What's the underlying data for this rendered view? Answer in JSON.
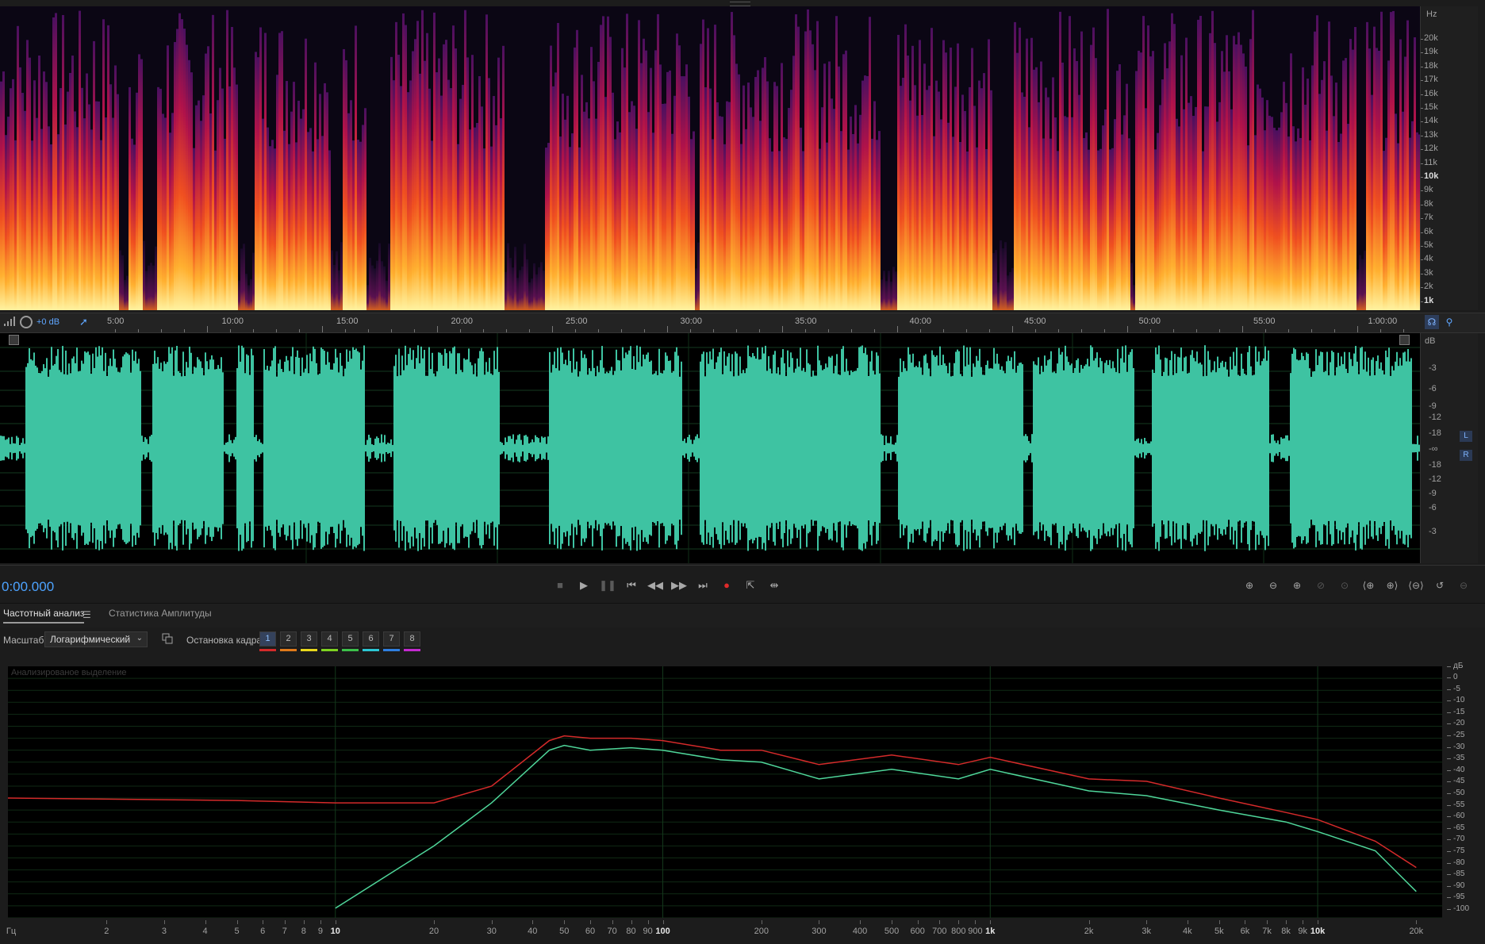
{
  "spectral": {
    "hz_unit": "Hz",
    "hz_ticks": [
      "20k",
      "19k",
      "18k",
      "17k",
      "16k",
      "15k",
      "14k",
      "13k",
      "12k",
      "11k",
      "10k",
      "9k",
      "8k",
      "7k",
      "6k",
      "5k",
      "4k",
      "3k",
      "2k",
      "1k"
    ]
  },
  "timeline": {
    "gain": "+0 dB",
    "labels": [
      "5:00",
      "10:00",
      "15:00",
      "20:00",
      "25:00",
      "30:00",
      "35:00",
      "40:00",
      "45:00",
      "50:00",
      "55:00",
      "1:00:00"
    ]
  },
  "waveform": {
    "db_unit": "dB",
    "db_ticks_top": [
      "-3",
      "-6",
      "-9",
      "-12",
      "-18",
      "-∞"
    ],
    "db_ticks_bottom": [
      "-18",
      "-12",
      "-9",
      "-6",
      "-3"
    ],
    "channels": [
      "L",
      "R"
    ],
    "color": "#3ec3a2"
  },
  "transport": {
    "timecode": "0:00.000",
    "buttons": [
      {
        "name": "stop-button",
        "glyph": "■",
        "enabled": false
      },
      {
        "name": "play-button",
        "glyph": "▶",
        "enabled": true
      },
      {
        "name": "pause-button",
        "glyph": "❚❚",
        "enabled": false
      },
      {
        "name": "go-to-start-button",
        "glyph": "⏮",
        "enabled": true
      },
      {
        "name": "rewind-button",
        "glyph": "◀◀",
        "enabled": true
      },
      {
        "name": "fast-forward-button",
        "glyph": "▶▶",
        "enabled": true
      },
      {
        "name": "go-to-end-button",
        "glyph": "⏭",
        "enabled": true
      },
      {
        "name": "record-button",
        "glyph": "●",
        "enabled": true
      },
      {
        "name": "loop-playback-button",
        "glyph": "⇱",
        "enabled": true
      },
      {
        "name": "skip-selection-button",
        "glyph": "⇹",
        "enabled": true
      }
    ],
    "zoom_buttons": [
      {
        "name": "zoom-in-amplitude-button",
        "glyph": "⊕",
        "enabled": true
      },
      {
        "name": "zoom-out-amplitude-button",
        "glyph": "⊖",
        "enabled": true
      },
      {
        "name": "zoom-in-time-button",
        "glyph": "⊕",
        "enabled": true
      },
      {
        "name": "zoom-out-full-button",
        "glyph": "⊘",
        "enabled": false
      },
      {
        "name": "zoom-selection-button",
        "glyph": "⊙",
        "enabled": false
      },
      {
        "name": "zoom-in-left-button",
        "glyph": "⟨⊕",
        "enabled": true
      },
      {
        "name": "zoom-in-right-button",
        "glyph": "⊕⟩",
        "enabled": true
      },
      {
        "name": "zoom-to-selection-button",
        "glyph": "⟨⊖⟩",
        "enabled": true
      },
      {
        "name": "zoom-reset-button",
        "glyph": "↺",
        "enabled": true
      },
      {
        "name": "zoom-out-button",
        "glyph": "⊖",
        "enabled": false
      }
    ]
  },
  "panel": {
    "tabs": [
      "Частотный анализ",
      "Статистика Амплитуды"
    ],
    "scale_label": "Масштаб:",
    "scale_value": "Логарифмический",
    "freeze_label": "Остановка кадра:",
    "frames": [
      {
        "label": "1",
        "color": "#d42a2a"
      },
      {
        "label": "2",
        "color": "#e07a1a"
      },
      {
        "label": "3",
        "color": "#e8d81c"
      },
      {
        "label": "4",
        "color": "#7ed321"
      },
      {
        "label": "5",
        "color": "#3cc04a"
      },
      {
        "label": "6",
        "color": "#2cc7d4"
      },
      {
        "label": "7",
        "color": "#2f7fe0"
      },
      {
        "label": "8",
        "color": "#c42ad0"
      }
    ],
    "spectrum_title": "Анализированое выделение",
    "db_unit": "дБ",
    "db_ticks": [
      "0",
      "-5",
      "-10",
      "-15",
      "-20",
      "-25",
      "-30",
      "-35",
      "-40",
      "-45",
      "-50",
      "-55",
      "-60",
      "-65",
      "-70",
      "-75",
      "-80",
      "-85",
      "-90",
      "-95",
      "-100"
    ],
    "hz_unit": "Гц",
    "freq_ticks": [
      "2",
      "3",
      "4",
      "5",
      "6",
      "7",
      "8",
      "9",
      "10",
      "20",
      "30",
      "40",
      "50",
      "60",
      "70",
      "80",
      "90",
      "100",
      "200",
      "300",
      "400",
      "500",
      "600",
      "700",
      "800",
      "900",
      "1k",
      "2k",
      "3k",
      "4k",
      "5k",
      "6k",
      "7k",
      "8k",
      "9k",
      "10k",
      "20k"
    ]
  },
  "chart_data": {
    "type": "line",
    "xlabel": "Гц",
    "ylabel": "дБ",
    "x_scale": "log",
    "xlim": [
      1,
      24000
    ],
    "ylim": [
      -100,
      5
    ],
    "x": [
      1,
      5,
      10,
      20,
      30,
      45,
      50,
      60,
      80,
      100,
      150,
      200,
      300,
      500,
      800,
      1000,
      2000,
      3000,
      5000,
      8000,
      10000,
      15000,
      20000
    ],
    "series": [
      {
        "color": "#d42a2a",
        "values": [
          -50,
          -51,
          -52,
          -52,
          -45,
          -26,
          -24,
          -25,
          -25,
          -26,
          -30,
          -32,
          -34,
          -34,
          -34,
          -35,
          -40,
          -45,
          -50,
          -56,
          -59,
          -68,
          -79
        ]
      },
      {
        "color": "#4fd69a",
        "values": [
          null,
          null,
          -96,
          -70,
          -52,
          -30,
          -28,
          -30,
          -29,
          -30,
          -34,
          -37,
          -40,
          -40,
          -40,
          -40,
          -45,
          -51,
          -55,
          -60,
          -64,
          -72,
          -89
        ]
      }
    ]
  }
}
